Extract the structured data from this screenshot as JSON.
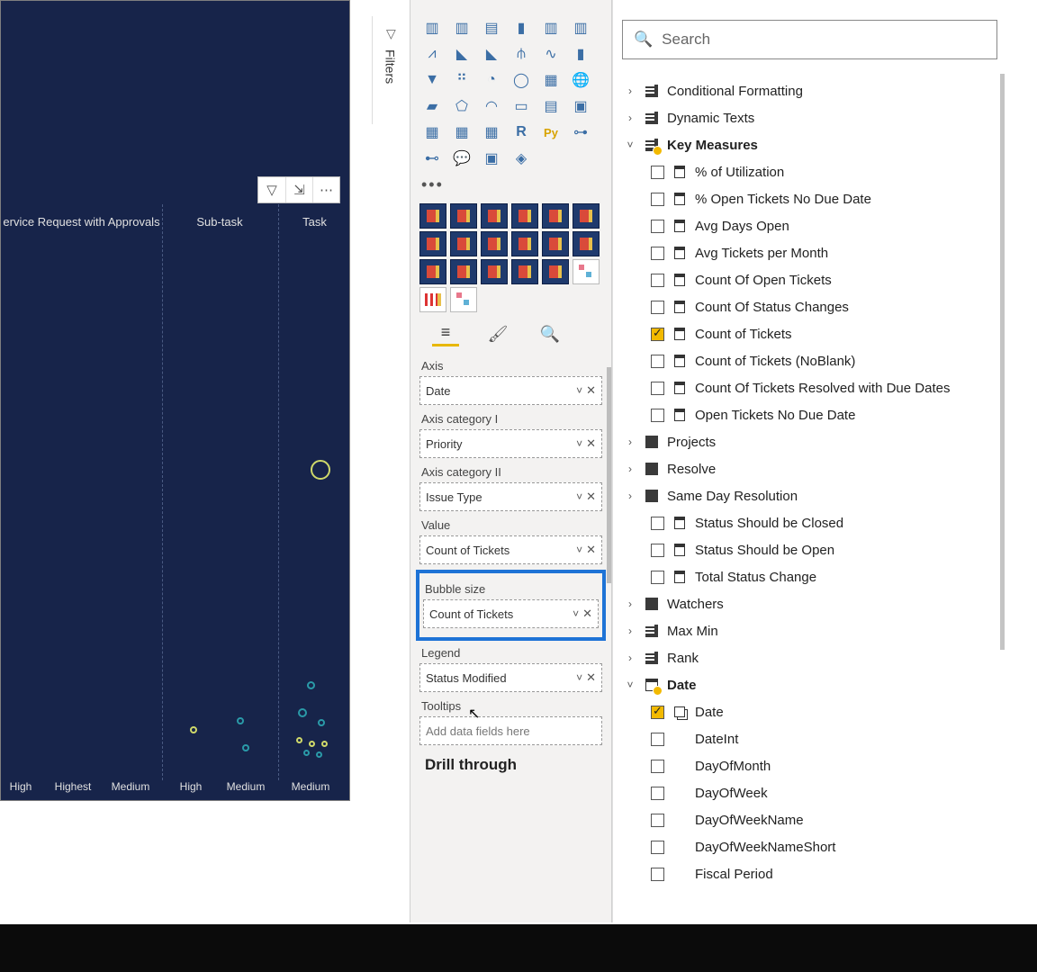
{
  "filters_label": "Filters",
  "search": {
    "placeholder": "Search"
  },
  "canvas": {
    "column_headers": [
      "ervice Request with Approvals",
      "Sub-task",
      "Task"
    ],
    "column_footers": [
      "High",
      "Highest",
      "Medium",
      "High",
      "Medium",
      "Medium"
    ]
  },
  "viz": {
    "ellipsis": "•••",
    "wells": {
      "axis_label": "Axis",
      "axis_value": "Date",
      "cat1_label": "Axis category I",
      "cat1_value": "Priority",
      "cat2_label": "Axis category II",
      "cat2_value": "Issue Type",
      "value_label": "Value",
      "value_value": "Count of Tickets",
      "bubble_label": "Bubble size",
      "bubble_value": "Count of Tickets",
      "legend_label": "Legend",
      "legend_value": "Status Modified",
      "tooltips_label": "Tooltips",
      "tooltips_placeholder": "Add data fields here"
    },
    "drill_label": "Drill through"
  },
  "fields": {
    "groups": [
      {
        "name": "Conditional Formatting",
        "icon": "table",
        "expanded": false
      },
      {
        "name": "Dynamic Texts",
        "icon": "table",
        "expanded": false
      },
      {
        "name": "Key Measures",
        "icon": "table",
        "expanded": true,
        "flag": true,
        "children": [
          {
            "name": "% of Utilization",
            "icon": "calc",
            "checked": false
          },
          {
            "name": "% Open Tickets No Due Date",
            "icon": "calc",
            "checked": false
          },
          {
            "name": "Avg Days Open",
            "icon": "calc",
            "checked": false
          },
          {
            "name": "Avg Tickets per Month",
            "icon": "calc",
            "checked": false
          },
          {
            "name": "Count Of Open Tickets",
            "icon": "calc",
            "checked": false
          },
          {
            "name": "Count Of Status Changes",
            "icon": "calc",
            "checked": false
          },
          {
            "name": "Count of Tickets",
            "icon": "calc",
            "checked": true
          },
          {
            "name": "Count of Tickets (NoBlank)",
            "icon": "calc",
            "checked": false
          },
          {
            "name": "Count Of Tickets Resolved with Due Dates",
            "icon": "calc",
            "checked": false
          },
          {
            "name": "Open Tickets No Due Date",
            "icon": "calc",
            "checked": false
          }
        ]
      },
      {
        "name": "Projects",
        "icon": "solid",
        "expanded": false
      },
      {
        "name": "Resolve",
        "icon": "solid",
        "expanded": false
      },
      {
        "name": "Same Day Resolution",
        "icon": "solid",
        "expanded": false,
        "children": [
          {
            "name": "Status Should be Closed",
            "icon": "calc",
            "checked": false
          },
          {
            "name": "Status Should be Open",
            "icon": "calc",
            "checked": false
          },
          {
            "name": "Total Status Change",
            "icon": "calc",
            "checked": false
          }
        ]
      },
      {
        "name": "Watchers",
        "icon": "solid",
        "expanded": false
      },
      {
        "name": "Max Min",
        "icon": "table",
        "expanded": false
      },
      {
        "name": "Rank",
        "icon": "table",
        "expanded": false
      },
      {
        "name": "Date",
        "icon": "date",
        "expanded": true,
        "flag": true,
        "children": [
          {
            "name": "Date",
            "icon": "hier",
            "checked": true
          },
          {
            "name": "DateInt",
            "icon": "none",
            "checked": false
          },
          {
            "name": "DayOfMonth",
            "icon": "none",
            "checked": false
          },
          {
            "name": "DayOfWeek",
            "icon": "none",
            "checked": false
          },
          {
            "name": "DayOfWeekName",
            "icon": "none",
            "checked": false
          },
          {
            "name": "DayOfWeekNameShort",
            "icon": "none",
            "checked": false
          },
          {
            "name": "Fiscal Period",
            "icon": "none",
            "checked": false
          }
        ]
      }
    ]
  }
}
